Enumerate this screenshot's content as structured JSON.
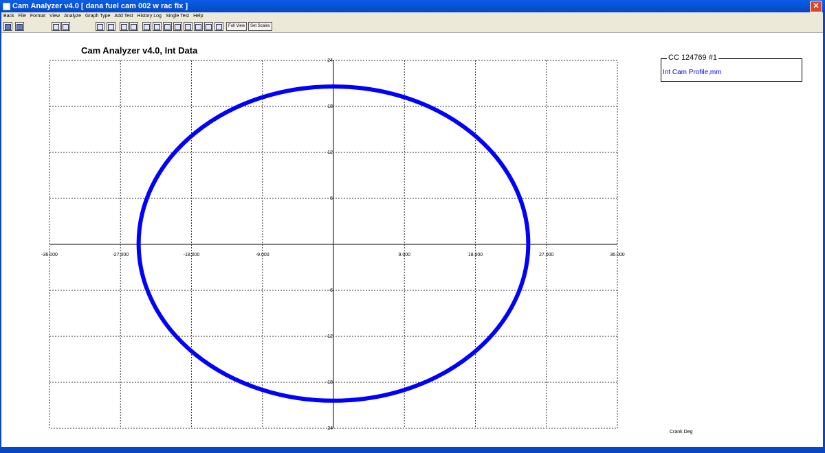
{
  "window": {
    "title": "Cam Analyzer v4.0  [ dana fuel cam 002 w rac fix ]",
    "close_glyph": "✕"
  },
  "menu": [
    "Back",
    "File",
    "Format",
    "View",
    "Analyze",
    "Graph Type",
    "Add Test",
    "History Log",
    "Single Test",
    "Help"
  ],
  "toolbar": {
    "icons": [
      "print-icon",
      "save-icon",
      "zoom-fit-icon",
      "zoom-select-icon",
      "graph-type-icon",
      "overlay-icon",
      "previous-icon",
      "next-icon",
      "pan-left-icon",
      "pan-right-icon",
      "pan-up-icon",
      "pan-down-icon",
      "stretch-x-icon",
      "shrink-x-icon",
      "stretch-y-icon",
      "shrink-y-icon"
    ],
    "full_view_label": "Full View",
    "set_scales_label": "Set Scales"
  },
  "chart": {
    "title": "Cam Analyzer v4.0,   Int Data",
    "legend_title": "CC 124769 #1",
    "legend_item": "Int Cam Profile,mm",
    "x_unit": "Crank Deg"
  },
  "chart_data": {
    "type": "line",
    "title": "Cam Analyzer v4.0,   Int Data",
    "xlabel": "Crank Deg",
    "ylabel": "",
    "xlim": [
      -36,
      36
    ],
    "ylim": [
      -24,
      24
    ],
    "x_ticks": [
      -36,
      -27,
      -18,
      -9,
      0,
      9,
      18,
      27,
      36
    ],
    "x_tick_labels": [
      "-36.000",
      "-27.000",
      "-18.000",
      "-9.000",
      "",
      "9.000",
      "18.000",
      "27.000",
      "36.000"
    ],
    "y_ticks": [
      24,
      18,
      12,
      6,
      0,
      -6,
      -12,
      -18,
      -24
    ],
    "y_tick_labels": [
      "24",
      "18",
      "12",
      "6",
      "",
      "-6",
      "-12",
      "-18",
      "-24"
    ],
    "grid": true,
    "legend_position": "top-right",
    "series": [
      {
        "name": "Int Cam Profile,mm",
        "color": "#0000ff",
        "shape": "closed profile (approximately elliptical)",
        "center": [
          0,
          -0.4
        ],
        "x_extent": [
          -24.7,
          24.7
        ],
        "y_extent": [
          -20.4,
          20.6
        ]
      }
    ]
  }
}
